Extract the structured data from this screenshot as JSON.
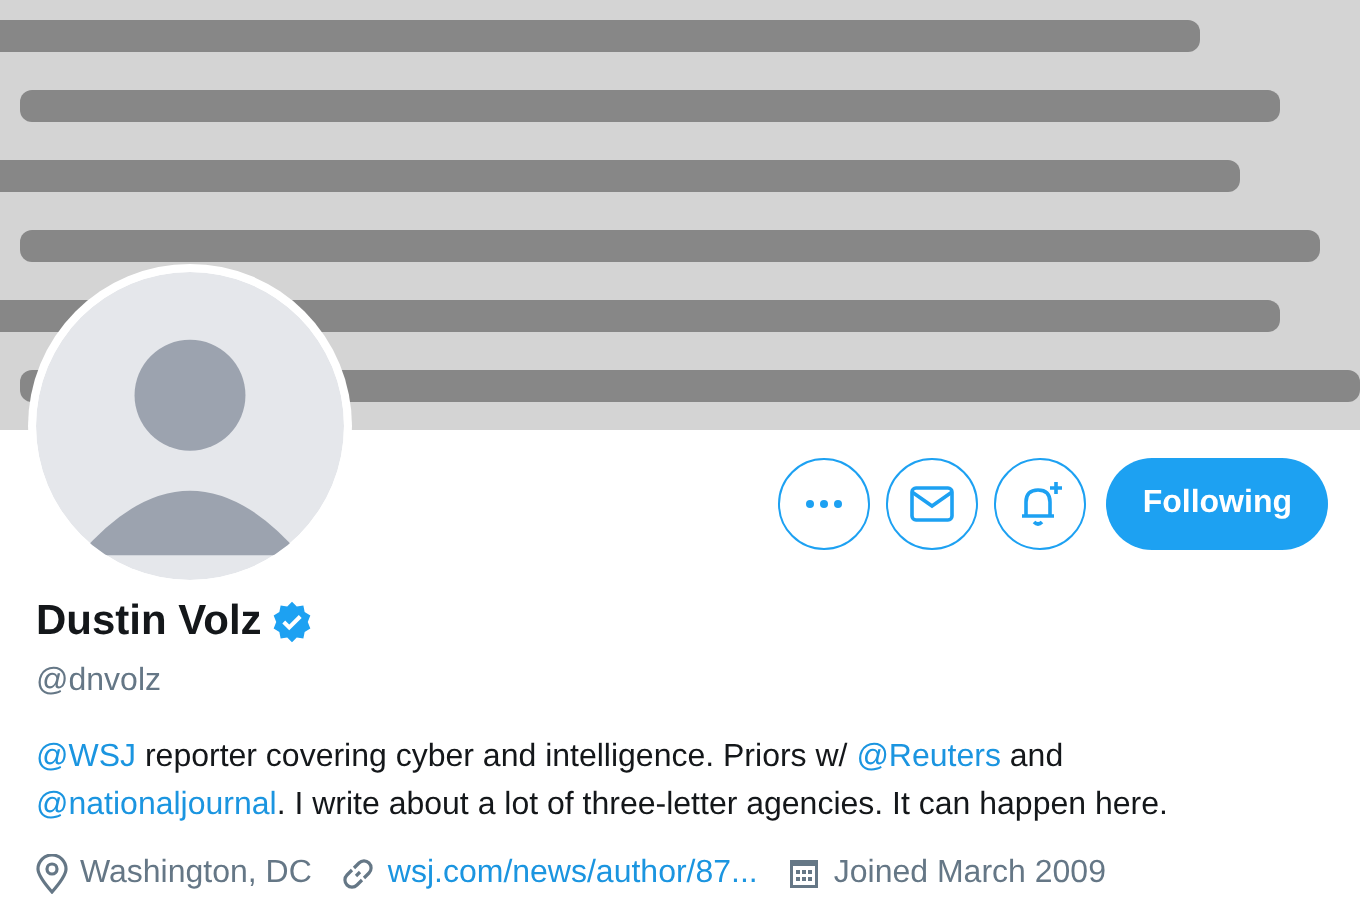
{
  "actions": [
    {
      "kind": "more"
    },
    {
      "kind": "message"
    },
    {
      "kind": "notify"
    }
  ],
  "follow_button": {
    "label": "Following"
  },
  "profile": {
    "name": "Dustin Volz",
    "verified": true,
    "handle": "@dnvolz"
  },
  "bio": [
    {
      "kind": "mention",
      "text": "@WSJ"
    },
    {
      "kind": "plain",
      "text": " reporter covering cyber and intelligence. Priors w/ "
    },
    {
      "kind": "mention",
      "text": "@Reuters"
    },
    {
      "kind": "plain",
      "text": " and "
    },
    {
      "kind": "mention",
      "text": "@nationaljournal"
    },
    {
      "kind": "plain",
      "text": ". I write about a lot of three-letter agencies. It can happen here."
    }
  ],
  "details": [
    {
      "kind": "location",
      "text": "Washington, DC"
    },
    {
      "kind": "link",
      "text": "wsj.com/news/author/87..."
    },
    {
      "kind": "joined",
      "text": "Joined March 2009"
    }
  ]
}
